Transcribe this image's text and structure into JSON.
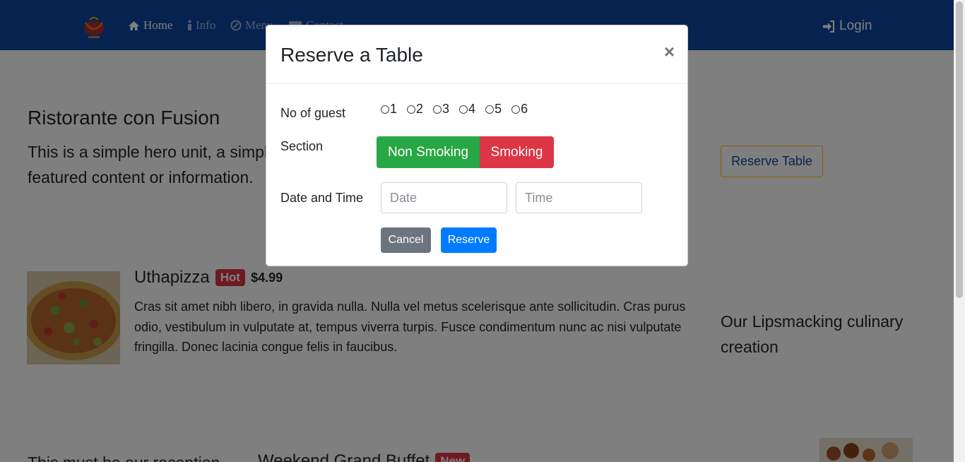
{
  "navbar": {
    "items": [
      {
        "label": "Home",
        "icon": "home-icon"
      },
      {
        "label": "Info",
        "icon": "info-icon"
      },
      {
        "label": "Menu",
        "icon": "menu-icon"
      },
      {
        "label": "Contact",
        "icon": "contact-icon"
      }
    ],
    "login_label": "Login",
    "bg_color": "#0d47a1"
  },
  "hero": {
    "title": "Ristorante con Fusion",
    "text": "This is a simple hero unit, a simple jumbotron-style component for calling extra attention to featured content or information.",
    "reserve_button": "Reserve Table"
  },
  "dish": {
    "name": "Uthapizza",
    "badge": "Hot",
    "price": "$4.99",
    "description": "Cras sit amet nibh libero, in gravida nulla. Nulla vel metus scelerisque ante sollicitudin. Cras purus odio, vestibulum in vulputate at, tempus viverra turpis. Fusce condimentum nunc ac nisi vulputate fringilla. Donec lacinia congue felis in faucibus."
  },
  "side_text": "Our Lipsmacking culinary creation",
  "bottom": {
    "text": "This must be our reception",
    "dish_name": "Weekend Grand Buffet",
    "badge": "New"
  },
  "modal": {
    "title": "Reserve a Table",
    "close_label": "×",
    "guests_label": "No of guest",
    "guest_options": [
      "1",
      "2",
      "3",
      "4",
      "5",
      "6"
    ],
    "section_label": "Section",
    "section_options": [
      "Non Smoking",
      "Smoking"
    ],
    "datetime_label": "Date and Time",
    "date_placeholder": "Date",
    "time_placeholder": "Time",
    "cancel_label": "Cancel",
    "reserve_label": "Reserve"
  },
  "colors": {
    "success": "#28a745",
    "danger": "#dc3545",
    "primary": "#007bff",
    "secondary": "#6c757d",
    "warning": "#ffc107"
  }
}
